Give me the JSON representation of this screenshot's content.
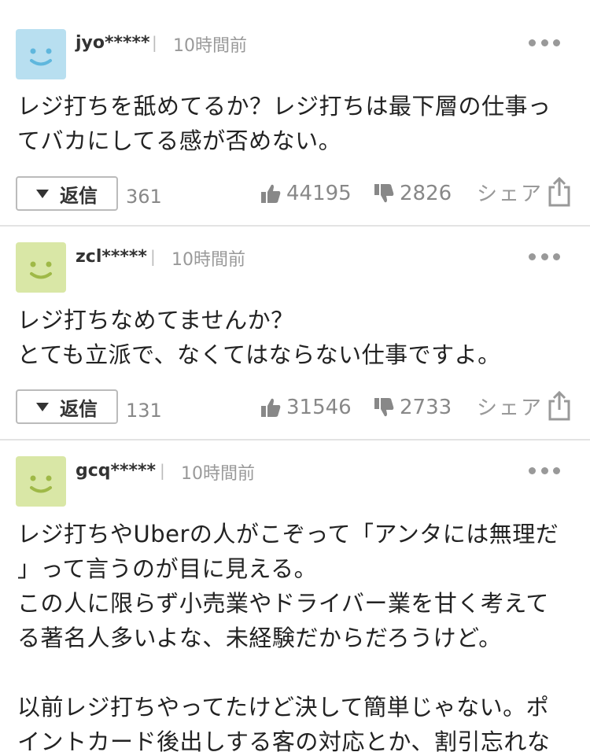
{
  "comments": [
    {
      "username": "jyo*****",
      "separator": "|",
      "time": "10時間前",
      "avatar_color": "#b8dff0",
      "avatar_face_color": "#5fb7dd",
      "body": "レジ打ちを舐めてるか？レジ打ちは最下層の仕事っ\nてバカにしてる感が否めない。",
      "reply_label": "返信",
      "reply_count": "361",
      "likes": "44195",
      "dislikes": "2826",
      "share_label": "シェア"
    },
    {
      "username": "zcl*****",
      "separator": "|",
      "time": "10時間前",
      "avatar_color": "#d9e7a6",
      "avatar_face_color": "#9fb947",
      "body": "レジ打ちなめてませんか？\nとても立派で、なくてはならない仕事ですよ。",
      "reply_label": "返信",
      "reply_count": "131",
      "likes": "31546",
      "dislikes": "2733",
      "share_label": "シェア"
    },
    {
      "username": "gcq*****",
      "separator": "|",
      "time": "10時間前",
      "avatar_color": "#d9e7a6",
      "avatar_face_color": "#9fb947",
      "body": "レジ打ちやUberの人がこぞって「アンタには無理だ\n」って言うのが目に見える。\nこの人に限らず小売業やドライバー業を甘く考えて\nる著名人多いよな、未経験だからだろうけど。\n\n以前レジ打ちやってたけど決して簡単じゃない。ポ\nイントカード後出しする客の対応とか、割引忘れな"
    }
  ]
}
